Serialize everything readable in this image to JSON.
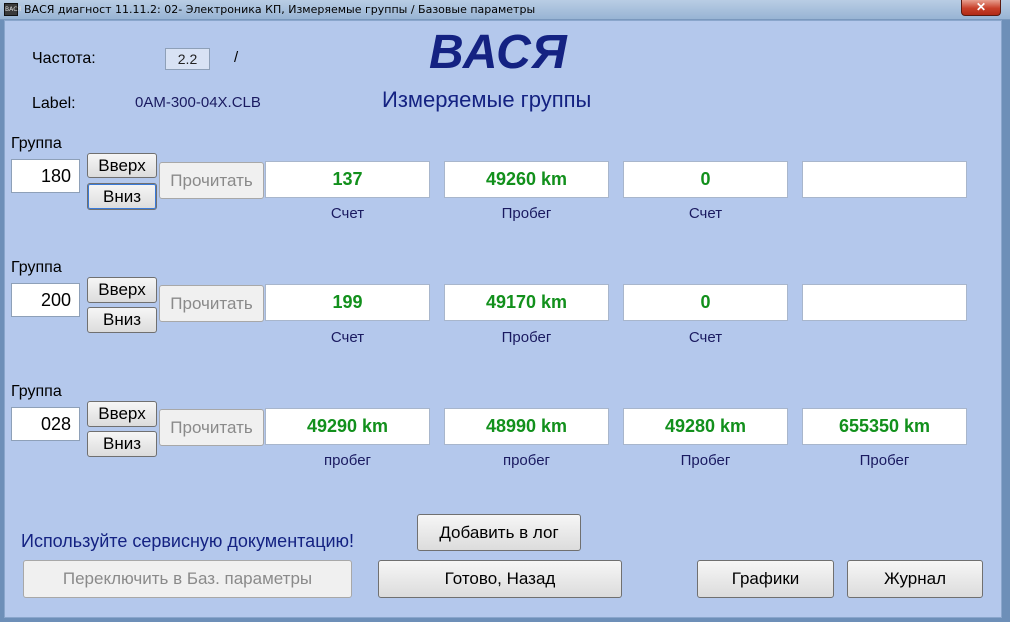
{
  "window": {
    "title": "ВАСЯ диагност 11.11.2: 02- Электроника КП,  Измеряемые группы / Базовые параметры",
    "close_glyph": "✕",
    "app_icon_text": "ВАСЯ"
  },
  "header": {
    "freq_label": "Частота:",
    "freq_value": "2.2",
    "freq_sep": "/",
    "label_label": "Label:",
    "label_value": "0AM-300-04X.CLB",
    "brand": "ВАСЯ",
    "subtitle": "Измеряемые группы"
  },
  "groups": [
    {
      "group_label": "Группа",
      "group_number": "180",
      "up_label": "Вверх",
      "down_label": "Вниз",
      "read_label": "Прочитать",
      "fields": [
        {
          "value": "137",
          "unit": "Счет"
        },
        {
          "value": "49260 km",
          "unit": "Пробег"
        },
        {
          "value": "0",
          "unit": "Счет"
        },
        {
          "value": "",
          "unit": ""
        }
      ]
    },
    {
      "group_label": "Группа",
      "group_number": "200",
      "up_label": "Вверх",
      "down_label": "Вниз",
      "read_label": "Прочитать",
      "fields": [
        {
          "value": "199",
          "unit": "Счет"
        },
        {
          "value": "49170 km",
          "unit": "Пробег"
        },
        {
          "value": "0",
          "unit": "Счет"
        },
        {
          "value": "",
          "unit": ""
        }
      ]
    },
    {
      "group_label": "Группа",
      "group_number": "028",
      "up_label": "Вверх",
      "down_label": "Вниз",
      "read_label": "Прочитать",
      "fields": [
        {
          "value": "49290 km",
          "unit": "пробег"
        },
        {
          "value": "48990 km",
          "unit": "пробег"
        },
        {
          "value": "49280 km",
          "unit": "Пробег"
        },
        {
          "value": "655350 km",
          "unit": "Пробег"
        }
      ]
    }
  ],
  "footer": {
    "notice": "Используйте сервисную документацию!",
    "add_log": "Добавить в лог",
    "switch_basic": "Переключить в Баз. параметры",
    "done_back": "Готово, Назад",
    "graphs": "Графики",
    "journal": "Журнал"
  },
  "colors": {
    "value_text": "#12901c",
    "brand": "#142282",
    "client_bg": "#b4c8ec"
  }
}
